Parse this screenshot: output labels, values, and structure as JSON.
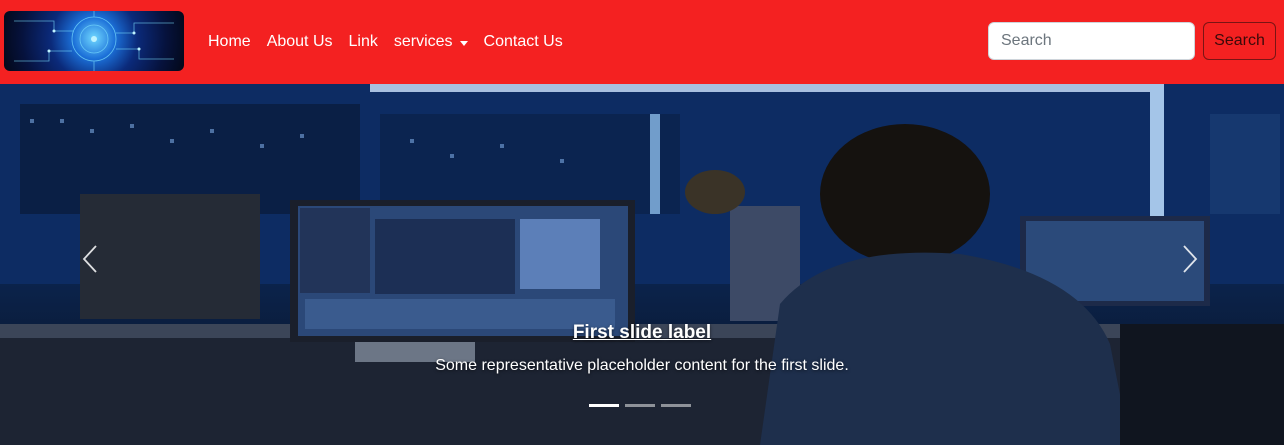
{
  "navbar": {
    "background": "#f42121",
    "brand_logo": "circuit-brain-logo",
    "links": [
      {
        "label": "Home"
      },
      {
        "label": "About Us"
      },
      {
        "label": "Link"
      },
      {
        "label": "services",
        "dropdown": true
      },
      {
        "label": "Contact Us"
      }
    ],
    "search": {
      "placeholder": "Search",
      "button_label": "Search"
    }
  },
  "carousel": {
    "slide": {
      "title": "First slide label",
      "text": "Some representative placeholder content for the first slide."
    },
    "indicators": [
      {
        "active": true
      },
      {
        "active": false
      },
      {
        "active": false
      }
    ],
    "prev_icon": "chevron-left-icon",
    "next_icon": "chevron-right-icon"
  }
}
